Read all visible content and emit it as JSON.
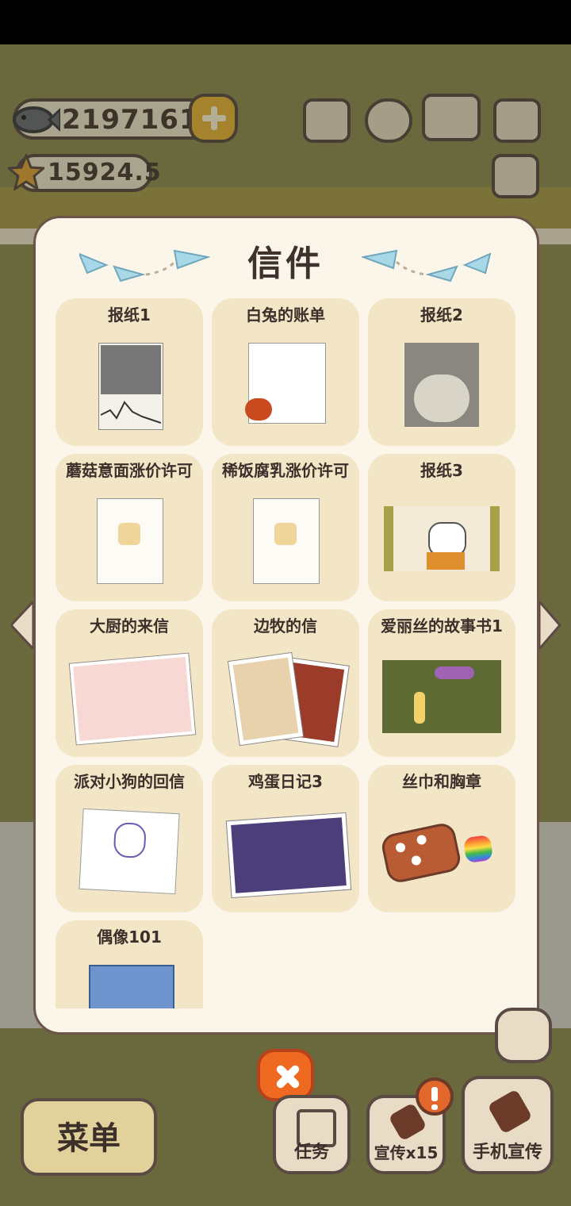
{
  "hud": {
    "fish_count": "2197161",
    "star_count": "15924.5"
  },
  "dialog": {
    "title": "信件",
    "letters": [
      {
        "label": "报纸1",
        "icon": "newspaper-icon"
      },
      {
        "label": "白兔的账单",
        "icon": "bill-icon"
      },
      {
        "label": "报纸2",
        "icon": "newspaper-icon"
      },
      {
        "label": "蘑菇意面涨价许可",
        "icon": "permit-icon"
      },
      {
        "label": "稀饭腐乳涨价许可",
        "icon": "permit-icon"
      },
      {
        "label": "报纸3",
        "icon": "mugshot-icon"
      },
      {
        "label": "大厨的来信",
        "icon": "photo-icon"
      },
      {
        "label": "边牧的信",
        "icon": "photo-icon"
      },
      {
        "label": "爱丽丝的故事书1",
        "icon": "storybook-icon"
      },
      {
        "label": "派对小狗的回信",
        "icon": "drawing-icon"
      },
      {
        "label": "鸡蛋日记3",
        "icon": "photo-icon"
      },
      {
        "label": "丝巾和胸章",
        "icon": "scarf-badge-icon"
      },
      {
        "label": "偶像101",
        "icon": "idol-booklet-icon"
      }
    ]
  },
  "bottom_bar": {
    "menu_label": "菜单",
    "task_label": "任务",
    "promo_label": "宣传x15",
    "phone_promo_label": "手机宣传"
  },
  "colors": {
    "panel_bg": "#fbf5ea",
    "card_bg": "#f3e6c7",
    "close_button": "#ef6a20",
    "outline": "#5a4a44"
  }
}
